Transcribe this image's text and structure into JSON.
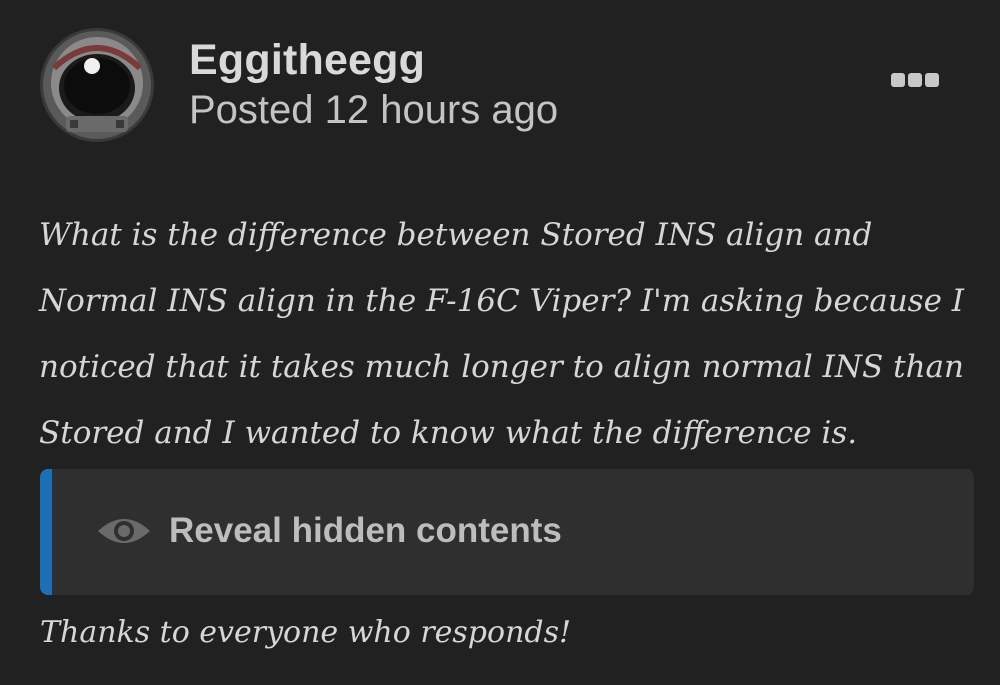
{
  "post": {
    "author": "Eggitheegg",
    "posted_time": "Posted 12 hours ago",
    "avatar_icon": "astronaut-helmet-avatar",
    "more_icon": "ellipsis-icon",
    "body_text": "What is the difference between Stored INS align and Normal INS align in the F-16C Viper? I'm asking because I noticed that it takes much longer to align normal INS than Stored and I wanted to know what the difference is.",
    "spoiler": {
      "label": "Reveal hidden contents",
      "icon": "eye-icon",
      "accent_color": "#1a6fb5"
    },
    "closing_text": "Thanks to everyone who responds!"
  },
  "colors": {
    "background": "#212121",
    "spoiler_background": "#2f2f2f",
    "text": "#d6d6d6"
  }
}
